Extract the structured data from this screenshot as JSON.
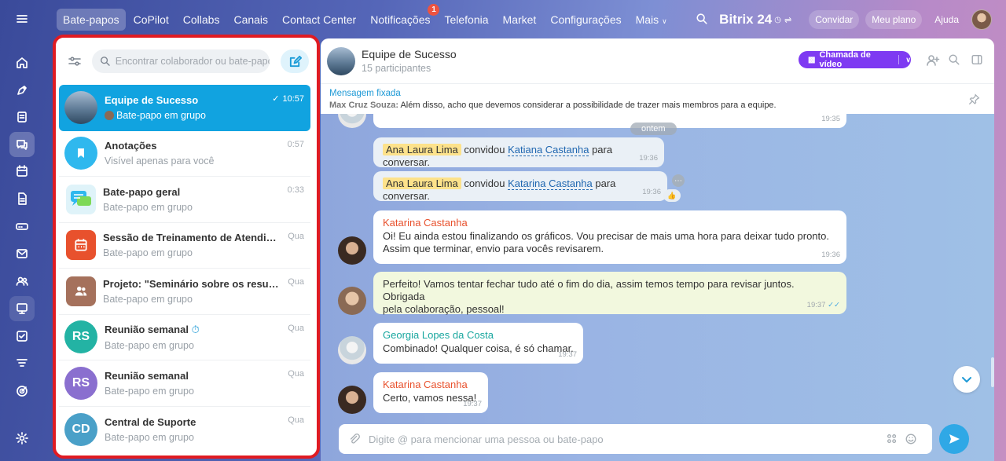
{
  "topbar": {
    "nav": [
      "Bate-papos",
      "CoPilot",
      "Collabs",
      "Canais",
      "Contact Center",
      "Notificações",
      "Telefonia",
      "Market",
      "Configurações",
      "Mais"
    ],
    "notifications_badge": "1",
    "brand": "Bitrix 24",
    "invite": "Convidar",
    "plan": "Meu plano",
    "help": "Ajuda"
  },
  "sidebar": {
    "search_placeholder": "Encontrar colaborador ou bate-papo"
  },
  "chats": [
    {
      "title": "Equipe de Sucesso",
      "sub": "Bate-papo em grupo",
      "time": "10:57"
    },
    {
      "title": "Anotações",
      "sub": "Visível apenas para você",
      "time": "0:57"
    },
    {
      "title": "Bate-papo geral",
      "sub": "Bate-papo em grupo",
      "time": "0:33"
    },
    {
      "title": "Sessão de Treinamento de Atendiment...",
      "sub": "Bate-papo em grupo",
      "time": "Qua"
    },
    {
      "title": "Projeto: \"Seminário sobre os resultado...",
      "sub": "Bate-papo em grupo",
      "time": "Qua"
    },
    {
      "title": "Reunião semanal",
      "sub": "Bate-papo em grupo",
      "time": "Qua",
      "initials": "RS"
    },
    {
      "title": "Reunião semanal",
      "sub": "Bate-papo em grupo",
      "time": "Qua",
      "initials": "RS"
    },
    {
      "title": "Central de Suporte",
      "sub": "Bate-papo em grupo",
      "time": "Qua",
      "initials": "CD"
    }
  ],
  "chat": {
    "title": "Equipe de Sucesso",
    "participants": "15 participantes",
    "video_button": "Chamada de vídeo",
    "pinned_label": "Mensagem fixada",
    "pinned_author": "Max Cruz Souza:",
    "pinned_text": "Além disso, acho que devemos considerar a possibilidade de trazer mais membros para a equipe.",
    "date_chip": "ontem",
    "composer_placeholder": "Digite @ para mencionar uma pessoa ou bate-papo"
  },
  "messages": [
    {
      "time": "19:35"
    },
    {
      "actor": "Ana Laura Lima",
      "verb": "convidou",
      "target": "Katiana Castanha",
      "rest": "para conversar.",
      "time": "19:36"
    },
    {
      "actor": "Ana Laura Lima",
      "verb": "convidou",
      "target": "Katarina Castanha",
      "rest": "para conversar.",
      "time": "19:36"
    },
    {
      "author": "Katarina Castanha",
      "line1": "Oi! Eu ainda estou finalizando os gráficos. Vou precisar de mais uma hora para deixar tudo pronto.",
      "line2": "Assim que terminar, envio para vocês revisarem.",
      "time": "19:36"
    },
    {
      "line1": "Perfeito! Vamos tentar fechar tudo até o fim do dia, assim temos tempo para revisar juntos. Obrigada",
      "line2": "pela colaboração, pessoal!",
      "time": "19:37"
    },
    {
      "author": "Georgia Lopes da Costa",
      "line1": "Combinado! Qualquer coisa, é só chamar.",
      "time": "19:37"
    },
    {
      "author": "Katarina Castanha",
      "line1": "Certo, vamos nessa!",
      "time": "19:37"
    }
  ],
  "colors": {
    "accent": "#11a3e0",
    "video": "#7e3af2",
    "highlight_border": "#e01b22"
  }
}
